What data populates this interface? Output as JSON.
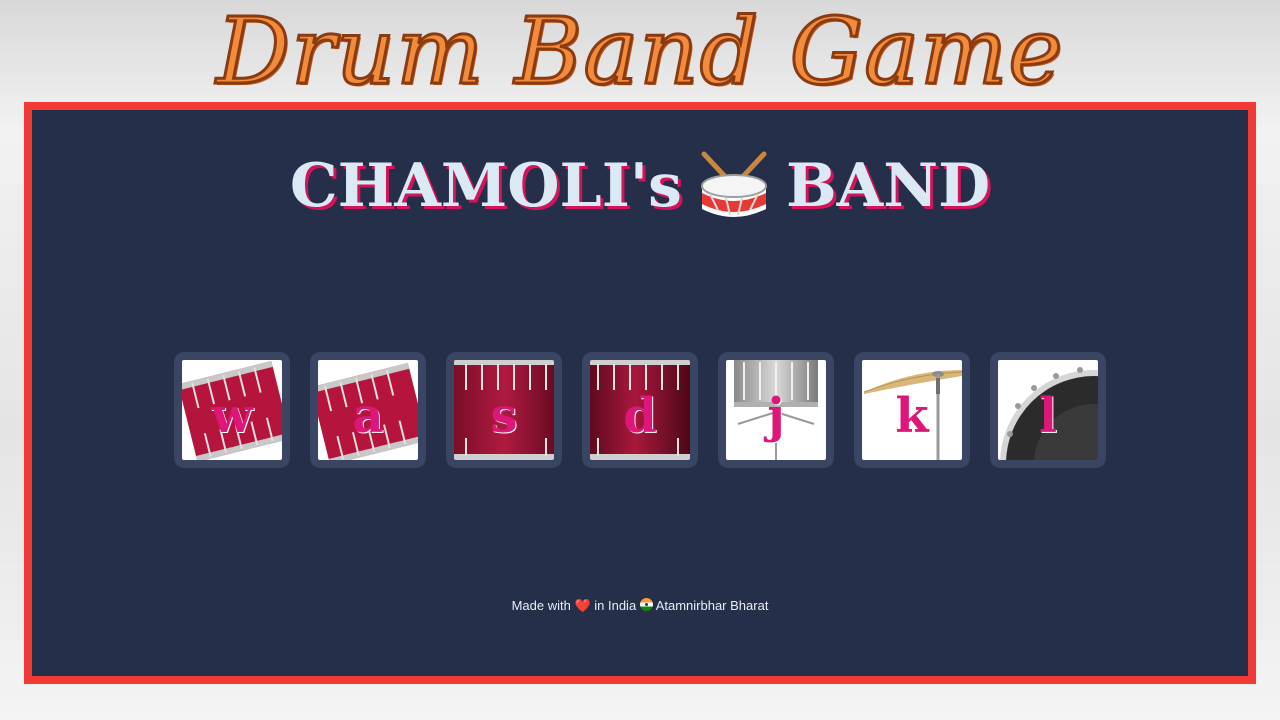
{
  "banner": {
    "title": "Drum Band Game"
  },
  "header": {
    "left": "CHAMOLI's",
    "right": "BAND",
    "icon": "drum-icon"
  },
  "drums": [
    {
      "key": "w",
      "instrument": "tom-tom-drum"
    },
    {
      "key": "a",
      "instrument": "tom-tom-drum"
    },
    {
      "key": "s",
      "instrument": "tom-drum"
    },
    {
      "key": "d",
      "instrument": "tom-drum"
    },
    {
      "key": "j",
      "instrument": "snare-drum"
    },
    {
      "key": "k",
      "instrument": "crash-cymbal"
    },
    {
      "key": "l",
      "instrument": "kick-drum"
    }
  ],
  "footer": {
    "made_with": "Made with",
    "heart": "❤️",
    "in_india": "in India",
    "flag_icon": "india-flag-icon",
    "tagline": "Atamnirbhar Bharat"
  },
  "colors": {
    "frame_border": "#f03a33",
    "panel": "#262f4a",
    "key_letter": "#de1679",
    "title_orange": "#f28c3a"
  }
}
